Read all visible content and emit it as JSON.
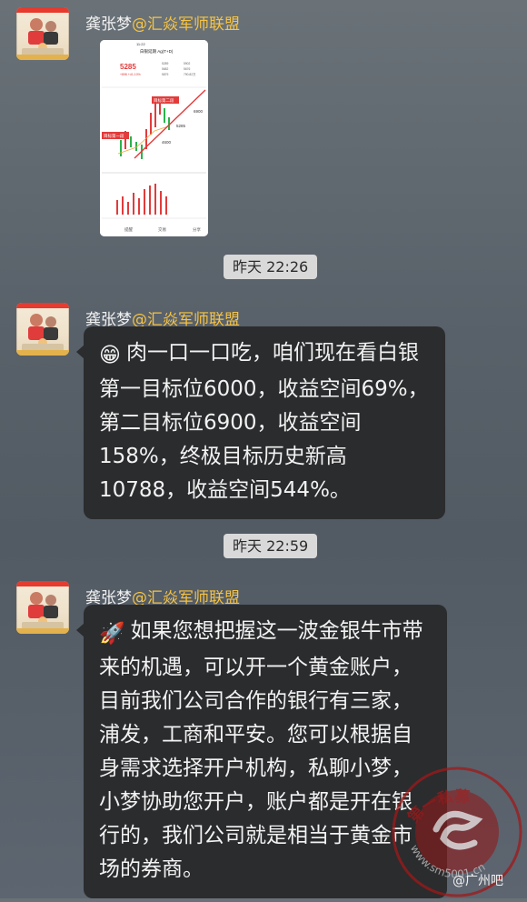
{
  "sender": {
    "name": "龚张梦",
    "group": "@汇焱军师联盟"
  },
  "timestamps": [
    "昨天 22:26",
    "昨天 22:59"
  ],
  "screenshot": {
    "status_time": "11:22",
    "title": "白银延期 Ag(T+D)",
    "price": "5285",
    "change": "+898 +41.10%",
    "stats": [
      "5289",
      "5682",
      "5879",
      "5902",
      "5676",
      "790.82万"
    ],
    "labels": {
      "first": "目标第一段",
      "second": "目标第二段",
      "p6900": "6900",
      "p5285": "5285",
      "p4600": "4600"
    },
    "buttons": [
      "提醒",
      "交易",
      "分享"
    ]
  },
  "messages": [
    {
      "emoji": "😁",
      "text": "肉一口一口吃，咱们现在看白银第一目标位6000，收益空间69%，第二目标位6900，收益空间158%，终极目标历史新高10788，收益空间544%。"
    },
    {
      "emoji": "🚀",
      "text": "如果您想把握这一波金银牛市带来的机遇，可以开一个黄金账户，目前我们公司合作的银行有三家，浦发，工商和平安。您可以根据自身需求选择开户机构，私聊小梦，小梦协助您开户，账户都是开在银行的，我们公司就是相当于黄金市场的券商。"
    }
  ],
  "watermark": {
    "text": "第一私募",
    "url": "www.sm5001.cn",
    "tieba": "@广州吧"
  }
}
